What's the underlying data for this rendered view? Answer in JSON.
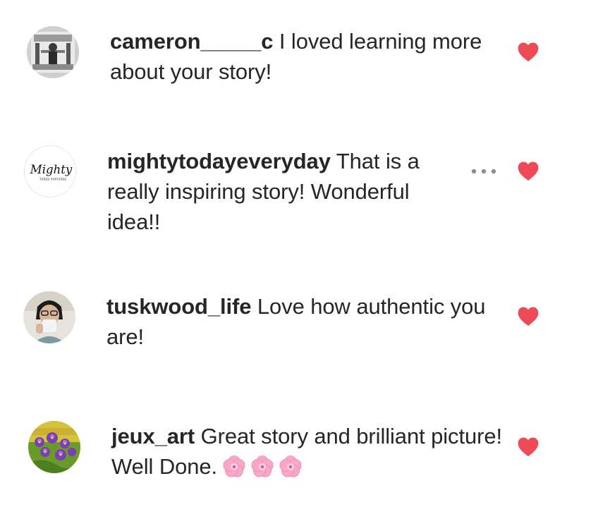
{
  "comments": [
    {
      "username": "cameron_____c",
      "text": " I loved learning more about your story!",
      "liked": true,
      "avatar_icon": "photo-avatar-grayscale"
    },
    {
      "username": "mightytodayeveryday",
      "text": " That is a really inspiring story! Wonderful idea!!",
      "liked": true,
      "show_more": true,
      "avatar_icon": "mighty-logo-avatar",
      "avatar_logo_text": "Mighty",
      "avatar_logo_subtext": "today everyday"
    },
    {
      "username": "tuskwood_life",
      "text": " Love how authentic you are!",
      "liked": true,
      "avatar_icon": "photo-avatar-person-mug"
    },
    {
      "username": "jeux_art",
      "text": " Great story and brilliant picture! Well Done.",
      "emoji_count": 3,
      "emoji_icon": "cherry-blossom-icon",
      "liked": true,
      "avatar_icon": "photo-avatar-flowers"
    }
  ],
  "colors": {
    "heart": "#ed4956",
    "text": "#262626",
    "more_dots": "#8e8e8e"
  }
}
